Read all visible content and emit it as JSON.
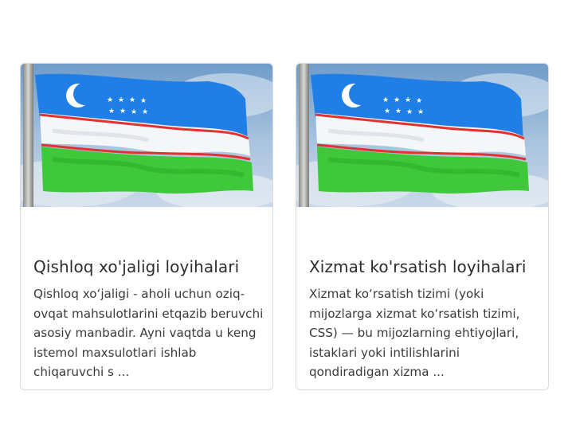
{
  "cards": [
    {
      "image": "uzbekistan-flag-photo",
      "title": "Qishloq xo'jaligi loyihalari",
      "text": "Qishloq xoʻjaligi - aholi uchun oziq-ovqat mahsulotlarini etqazib beruvchi asosiy manbadir. Ayni vaqtda u keng istemol maxsulotlari ishlab chiqaruvchi s ..."
    },
    {
      "image": "uzbekistan-flag-photo",
      "title": "Xizmat ko'rsatish loyihalari",
      "text": "Xizmat koʻrsatish tizimi (yoki mijozlarga xizmat koʻrsatish tizimi, CSS) — bu mijozlarning ehtiyojlari, istaklari yoki intilishlarini qondiradigan xizma ..."
    }
  ],
  "colors": {
    "flag_blue": "#1f7fe6",
    "flag_white": "#f4f6f8",
    "flag_red": "#e3312f",
    "flag_green": "#3fc83a",
    "sky": "#8fb3d6",
    "card_border": "#d9dde2"
  }
}
